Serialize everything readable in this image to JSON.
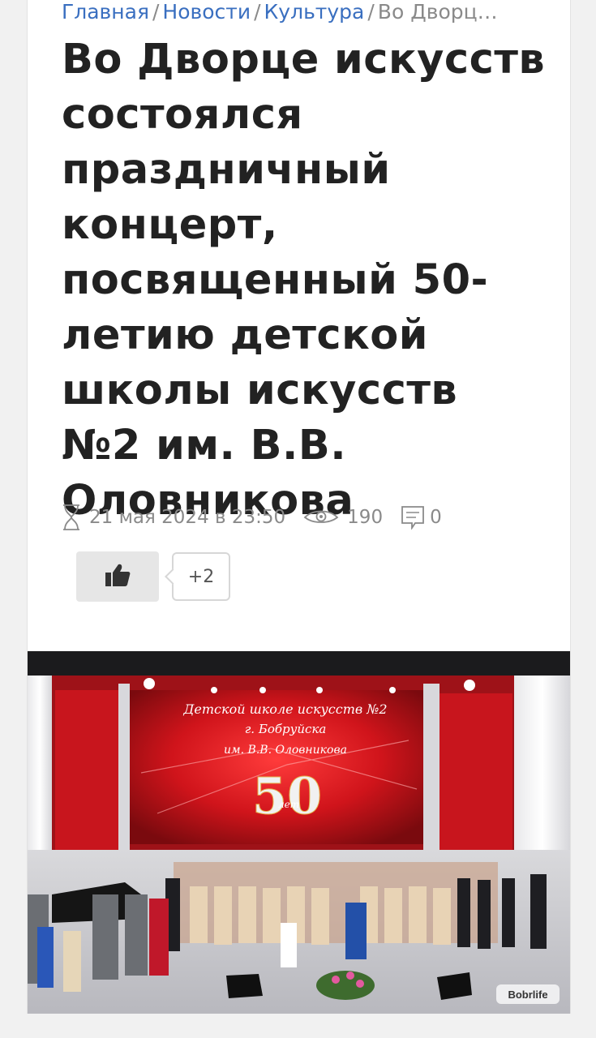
{
  "breadcrumb": {
    "home": "Главная",
    "news": "Новости",
    "culture": "Культура",
    "current": "Во Дворц…",
    "separator": "/"
  },
  "article": {
    "title": "Во Дворце искусств состоялся праздничный концерт, посвященный 50-летию детской школы искусств №2 им. В.В. Оловникова",
    "date": "21 мая 2024 в 23:50",
    "views": "190",
    "comments": "0",
    "likes": "+2"
  },
  "photo": {
    "screen_line1": "Детской школе искусств №2",
    "screen_line2": "г. Бобруйска",
    "screen_line3": "им. В.В. Оловникова",
    "screen_number": "50",
    "screen_small": "лет",
    "watermark": "Bobrlife"
  },
  "icons": {
    "date": "hourglass-icon",
    "views": "eye-icon",
    "comments": "comment-icon",
    "like": "thumbs-up-icon"
  },
  "colors": {
    "link": "#3a6fc0",
    "title": "#222222",
    "meta": "#8a8a8a",
    "stage_red": "#c8151d"
  }
}
